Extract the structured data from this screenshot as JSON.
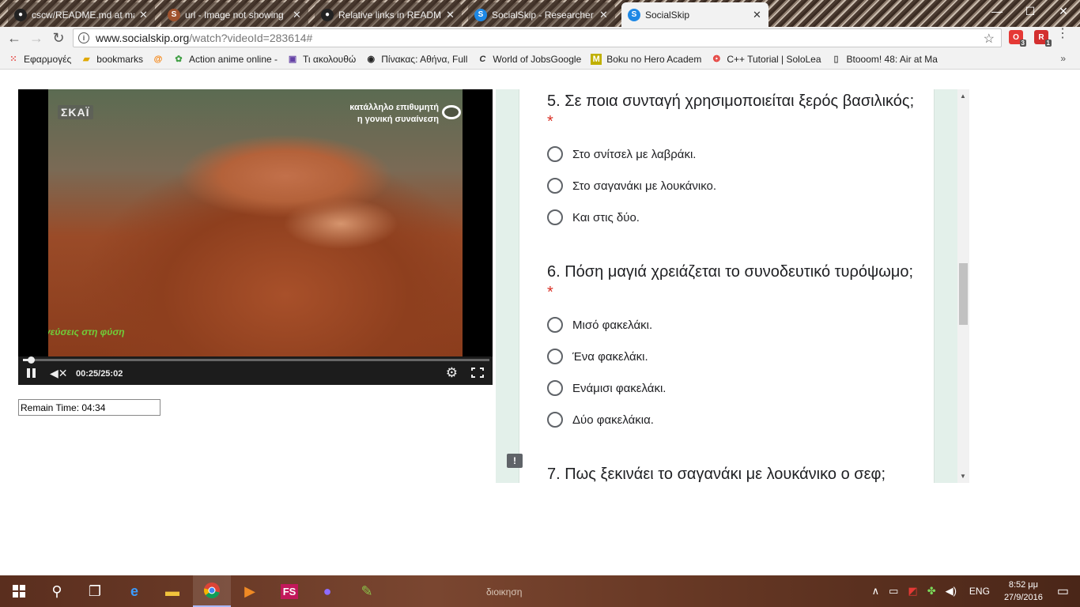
{
  "browser": {
    "tabs": [
      {
        "title": "cscw/README.md at ma",
        "favicon_color": "#222222",
        "active": false
      },
      {
        "title": "url - Image not showing",
        "favicon_color": "#a0522d",
        "active": false
      },
      {
        "title": "Relative links in READM",
        "favicon_color": "#222222",
        "active": false
      },
      {
        "title": "SocialSkip - Researcher",
        "favicon_color": "#1e88e5",
        "active": false
      },
      {
        "title": "SocialSkip",
        "favicon_color": "#1e88e5",
        "active": true
      }
    ],
    "url": {
      "host": "www.socialskip.org",
      "path": "/watch?videoId=283614#"
    },
    "extensions": [
      {
        "label": "O",
        "badge": "3",
        "color": "#e53935"
      },
      {
        "label": "R",
        "badge": "1",
        "color": "#d32f2f"
      }
    ],
    "bookmarks": [
      {
        "label": "Εφαρμογές",
        "icon": "apps-icon",
        "color": "#e53935"
      },
      {
        "label": "bookmarks",
        "icon": "folder-icon",
        "color": "#e0a800"
      },
      {
        "label": "",
        "icon": "at-icon",
        "color": "#f57c00"
      },
      {
        "label": "Action anime online -",
        "icon": "anime-icon",
        "color": "#43a047"
      },
      {
        "label": "Τι ακολουθώ",
        "icon": "twitch-icon",
        "color": "#6441a5"
      },
      {
        "label": "Πίνακας: Αθήνα, Full",
        "icon": "trello-icon",
        "color": "#222222"
      },
      {
        "label": "World of JobsGoogle",
        "icon": "c-icon",
        "color": "#333333"
      },
      {
        "label": "Boku no Hero Academ",
        "icon": "manga-icon",
        "color": "#c0b000"
      },
      {
        "label": "C++ Tutorial | SoloLea",
        "icon": "sololearn-icon",
        "color": "#e53935"
      },
      {
        "label": "Btooom! 48: Air at Ma",
        "icon": "page-icon",
        "color": "#555555"
      }
    ],
    "bookmarks_more": "»"
  },
  "video": {
    "channel_logo": "ΣΚΑΪ",
    "rating_line1": "κατάλληλο επιθυμητή",
    "rating_line2": "η γονική συναίνεση",
    "caption": "γεύσεις στη φύση",
    "current_time": "00:25",
    "duration": "25:02",
    "time_text": "00:25/25:02",
    "progress_fraction": 0.017
  },
  "remain": {
    "text": "Remain Time: 04:34"
  },
  "form": {
    "questions": [
      {
        "title": "5. Σε ποια συνταγή χρησιμοποιείται ξερός βασιλικός;",
        "required_mark": "*",
        "options": [
          "Στο σνίτσελ με λαβράκι.",
          "Στο σαγανάκι με λουκάνικο.",
          "Και στις δύο."
        ]
      },
      {
        "title": "6. Πόση μαγιά χρειάζεται το συνοδευτικό τυρόψωμο;",
        "required_mark": "*",
        "options": [
          "Μισό φακελάκι.",
          "Ένα φακελάκι.",
          "Ενάμισι φακελάκι.",
          "Δύο φακελάκια."
        ]
      },
      {
        "title": "7. Πως ξεκινάει το σαγανάκι με λουκάνικο ο σεφ;"
      }
    ]
  },
  "taskbar": {
    "items": [
      "start-icon",
      "search-icon",
      "task-view-icon",
      "edge-icon",
      "file-explorer-icon",
      "chrome-icon",
      "media-player-icon",
      "fs-icon",
      "app-cat-icon",
      "notepad-icon"
    ],
    "fs_label": "FS",
    "desktop_peek_text": "διοικηση",
    "language": "ENG",
    "time": "8:52 μμ",
    "date": "27/9/2016"
  }
}
